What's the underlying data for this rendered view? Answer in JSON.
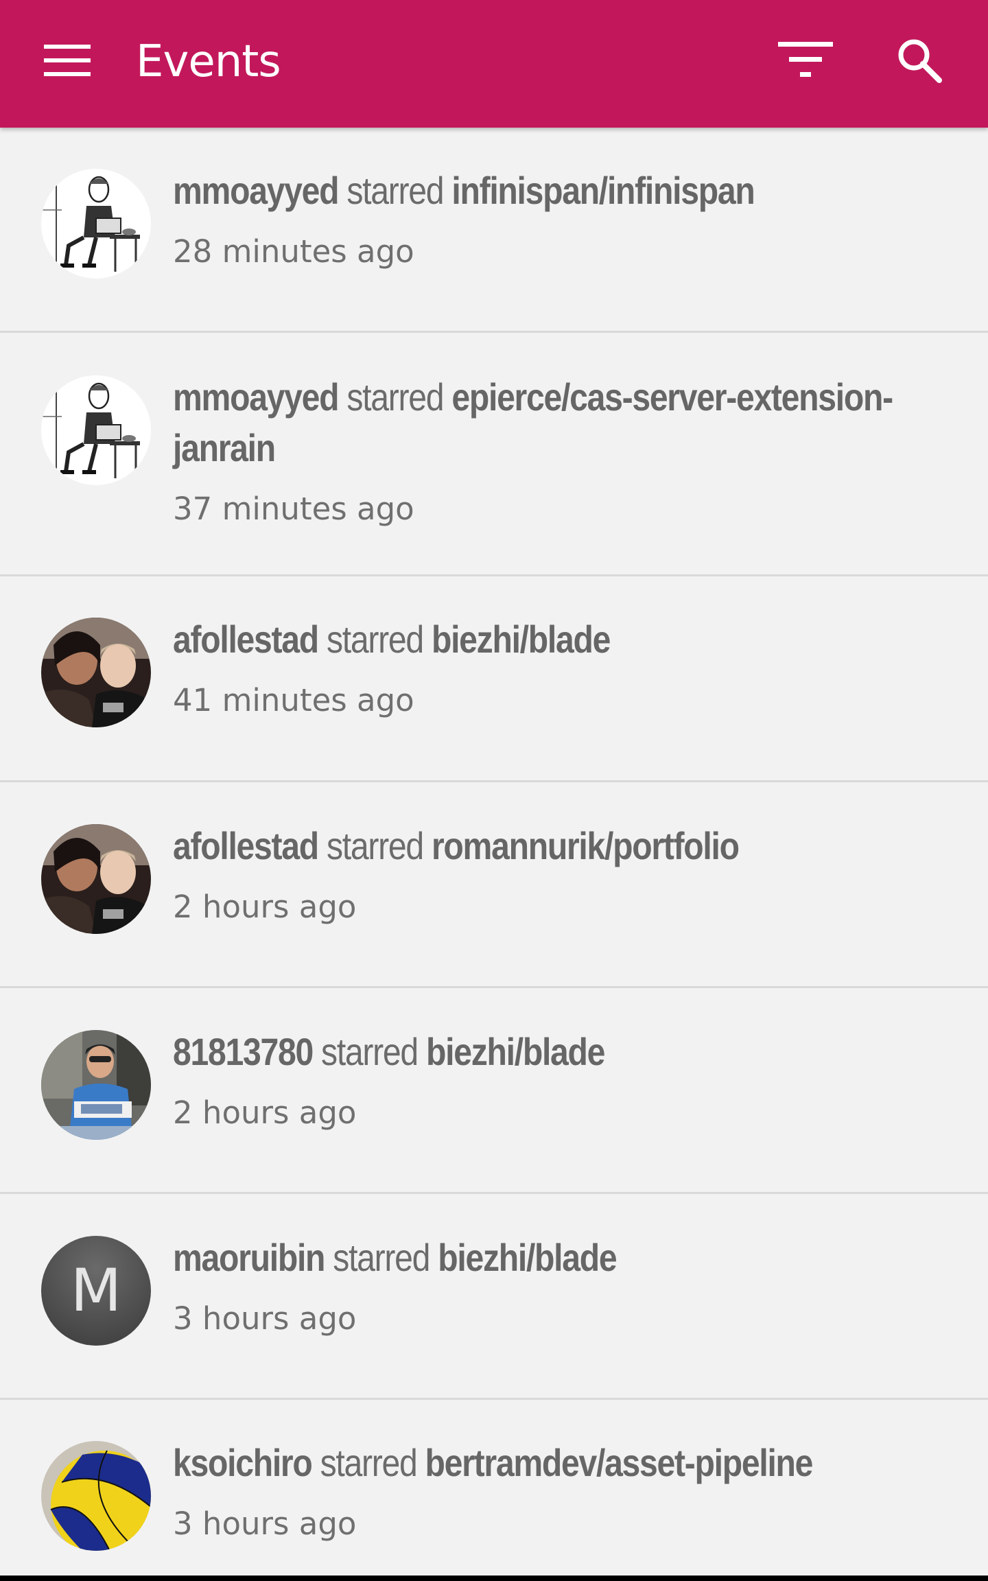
{
  "toolbar": {
    "title": "Events",
    "background_color": "#c2185b",
    "menu_icon": "menu-icon",
    "filter_icon": "filter-icon",
    "search_icon": "search-icon"
  },
  "events": [
    {
      "actor": "mmoayyed",
      "action": "starred",
      "repo": "infinispan/infinispan",
      "time": "28 minutes ago",
      "avatar": "sketch-man-avatar"
    },
    {
      "actor": "mmoayyed",
      "action": "starred",
      "repo": "epierce/cas-server-extension-janrain",
      "time": "37 minutes ago",
      "avatar": "sketch-man-avatar"
    },
    {
      "actor": "afollestad",
      "action": "starred",
      "repo": "biezhi/blade",
      "time": "41 minutes ago",
      "avatar": "couple-selfie-avatar"
    },
    {
      "actor": "afollestad",
      "action": "starred",
      "repo": "romannurik/portfolio",
      "time": "2 hours ago",
      "avatar": "couple-selfie-avatar"
    },
    {
      "actor": "81813780",
      "action": "starred",
      "repo": "biezhi/blade",
      "time": "2 hours ago",
      "avatar": "person-photo-avatar"
    },
    {
      "actor": "maoruibin",
      "action": "starred",
      "repo": "biezhi/blade",
      "time": "3 hours ago",
      "avatar": "letter-avatar",
      "avatar_letter": "M"
    },
    {
      "actor": "ksoichiro",
      "action": "starred",
      "repo": "bertramdev/asset-pipeline",
      "time": "3 hours ago",
      "avatar": "volleyball-avatar"
    }
  ]
}
